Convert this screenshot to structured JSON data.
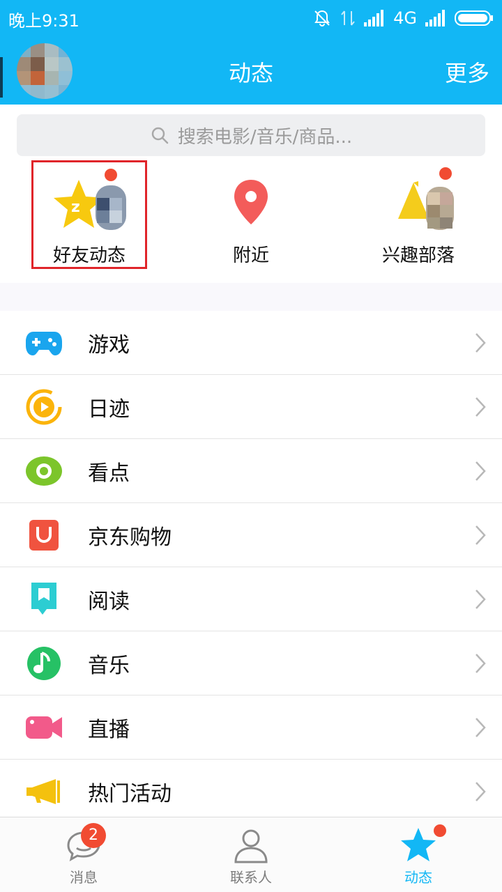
{
  "status_bar": {
    "time": "晚上9:31",
    "network": "4G"
  },
  "header": {
    "title": "动态",
    "more_label": "更多"
  },
  "search": {
    "placeholder": "搜索电影/音乐/商品..."
  },
  "quick_entries": [
    {
      "label": "好友动态",
      "icon": "star-icon",
      "has_dot": true,
      "highlighted": true
    },
    {
      "label": "附近",
      "icon": "location-pin-icon",
      "has_dot": false
    },
    {
      "label": "兴趣部落",
      "icon": "tribe-icon",
      "has_dot": true
    }
  ],
  "list": [
    {
      "label": "游戏",
      "icon": "gamepad-icon",
      "color": "#1aa5ee"
    },
    {
      "label": "日迹",
      "icon": "play-circle-icon",
      "color": "#fbb40b"
    },
    {
      "label": "看点",
      "icon": "eye-icon",
      "color": "#7cc52b"
    },
    {
      "label": "京东购物",
      "icon": "shopping-bag-icon",
      "color": "#f0533f"
    },
    {
      "label": "阅读",
      "icon": "bookmark-icon",
      "color": "#2ccdd2"
    },
    {
      "label": "音乐",
      "icon": "music-note-icon",
      "color": "#26c165"
    },
    {
      "label": "直播",
      "icon": "video-camera-icon",
      "color": "#f25a8a"
    },
    {
      "label": "热门活动",
      "icon": "megaphone-icon",
      "color": "#f4c10e"
    }
  ],
  "tabbar": [
    {
      "label": "消息",
      "icon": "chat-bubble-icon",
      "badge": "2",
      "active": false
    },
    {
      "label": "联系人",
      "icon": "contacts-icon",
      "active": false
    },
    {
      "label": "动态",
      "icon": "star-tab-icon",
      "active": true,
      "has_dot": true
    }
  ],
  "colors": {
    "brand": "#12b7f5",
    "red_dot": "#f14b32",
    "highlight": "#e0252a"
  }
}
